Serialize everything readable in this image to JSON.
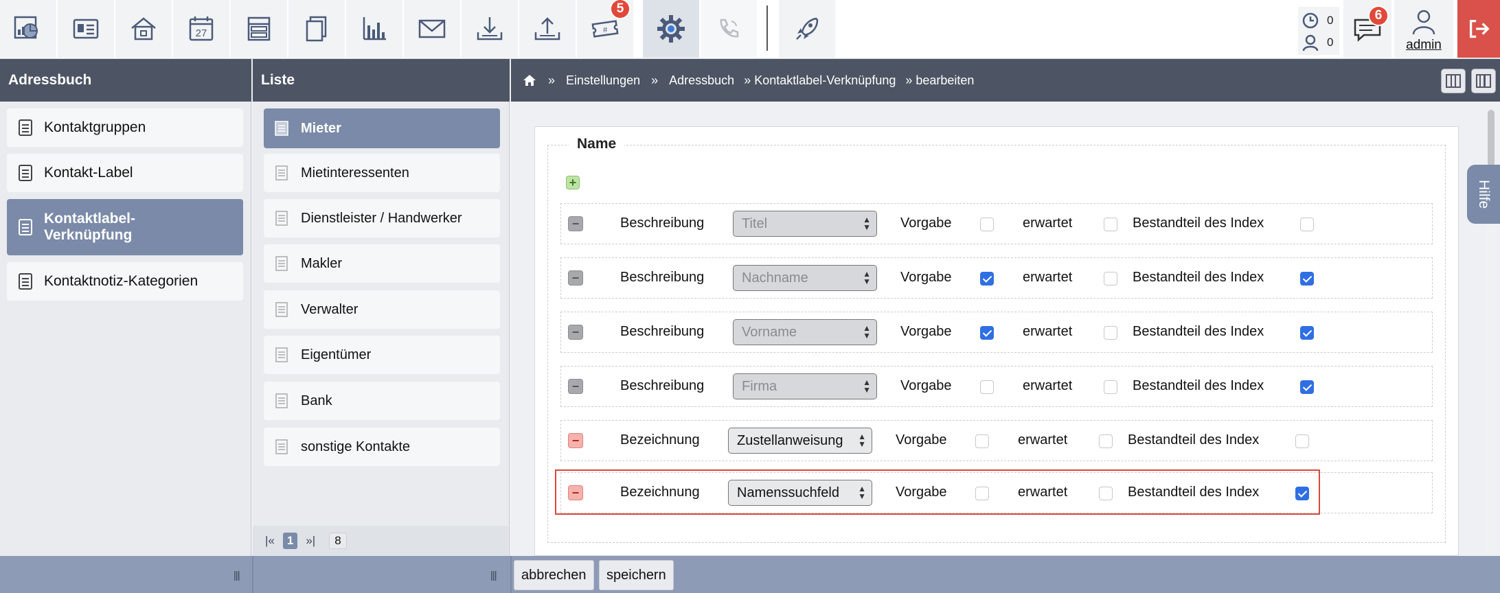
{
  "toolbar": {
    "icons": [
      "dashboard-icon",
      "address-card-icon",
      "house-icon",
      "calendar-icon",
      "layout-icon",
      "documents-icon",
      "chart-icon",
      "mail-icon",
      "download-icon",
      "upload-icon",
      "ticket-icon",
      "gear-icon",
      "phone-icon",
      "rocket-icon"
    ],
    "calendar_day": "27",
    "ticket_badge": "5",
    "counter_1": "0",
    "counter_2": "0",
    "messages_badge": "6",
    "user": "admin"
  },
  "left": {
    "title": "Adressbuch",
    "items": [
      {
        "label": "Kontaktgruppen",
        "active": false
      },
      {
        "label": "Kontakt-Label",
        "active": false
      },
      {
        "label": "Kontaktlabel-Verknüpfung",
        "label_l1": "Kontaktlabel-",
        "label_l2": "Verknüpfung",
        "active": true
      },
      {
        "label": "Kontaktnotiz-Kategorien",
        "active": false
      }
    ]
  },
  "middle": {
    "title": "Liste",
    "items": [
      {
        "label": "Mieter",
        "active": true
      },
      {
        "label": "Mietinteressenten",
        "active": false
      },
      {
        "label": "Dienstleister / Handwerker",
        "active": false
      },
      {
        "label": "Makler",
        "active": false
      },
      {
        "label": "Verwalter",
        "active": false
      },
      {
        "label": "Eigentümer",
        "active": false
      },
      {
        "label": "Bank",
        "active": false
      },
      {
        "label": "sonstige Kontakte",
        "active": false
      }
    ],
    "pager": {
      "first": "|«",
      "current": "1",
      "last": "»|",
      "total": "8"
    }
  },
  "breadcrumb": {
    "sep": "»",
    "items": [
      "Einstellungen",
      "Adressbuch",
      "» Kontaktlabel-Verknüpfung",
      "» bearbeiten"
    ]
  },
  "form": {
    "legend": "Name",
    "rows": [
      {
        "label": "Beschreibung",
        "select": "Titel",
        "enabled": false,
        "vorgabe": false,
        "erwartet": false,
        "index": false
      },
      {
        "label": "Beschreibung",
        "select": "Nachname",
        "enabled": false,
        "vorgabe": true,
        "erwartet": false,
        "index": true
      },
      {
        "label": "Beschreibung",
        "select": "Vorname",
        "enabled": false,
        "vorgabe": true,
        "erwartet": false,
        "index": true
      },
      {
        "label": "Beschreibung",
        "select": "Firma",
        "enabled": false,
        "vorgabe": false,
        "erwartet": false,
        "index": true
      },
      {
        "label": "Bezeichnung",
        "select": "Zustellanweisung",
        "enabled": true,
        "vorgabe": false,
        "erwartet": false,
        "index": false
      },
      {
        "label": "Bezeichnung",
        "select": "Namenssuchfeld",
        "enabled": true,
        "vorgabe": false,
        "erwartet": false,
        "index": true
      }
    ],
    "col_vorgabe": "Vorgabe",
    "col_erwartet": "erwartet",
    "col_index": "Bestandteil des Index"
  },
  "help": "Hilfe",
  "footer": {
    "cancel": "abbrechen",
    "save": "speichern",
    "resize_glyph": "|||"
  },
  "colors": {
    "header": "#4d5463",
    "accent": "#7a8aa8",
    "footer": "#8e9bb6",
    "badge": "#e2483a",
    "logout": "#d9514a",
    "checkbox": "#2f6fe3",
    "highlight": "#d9483b"
  }
}
